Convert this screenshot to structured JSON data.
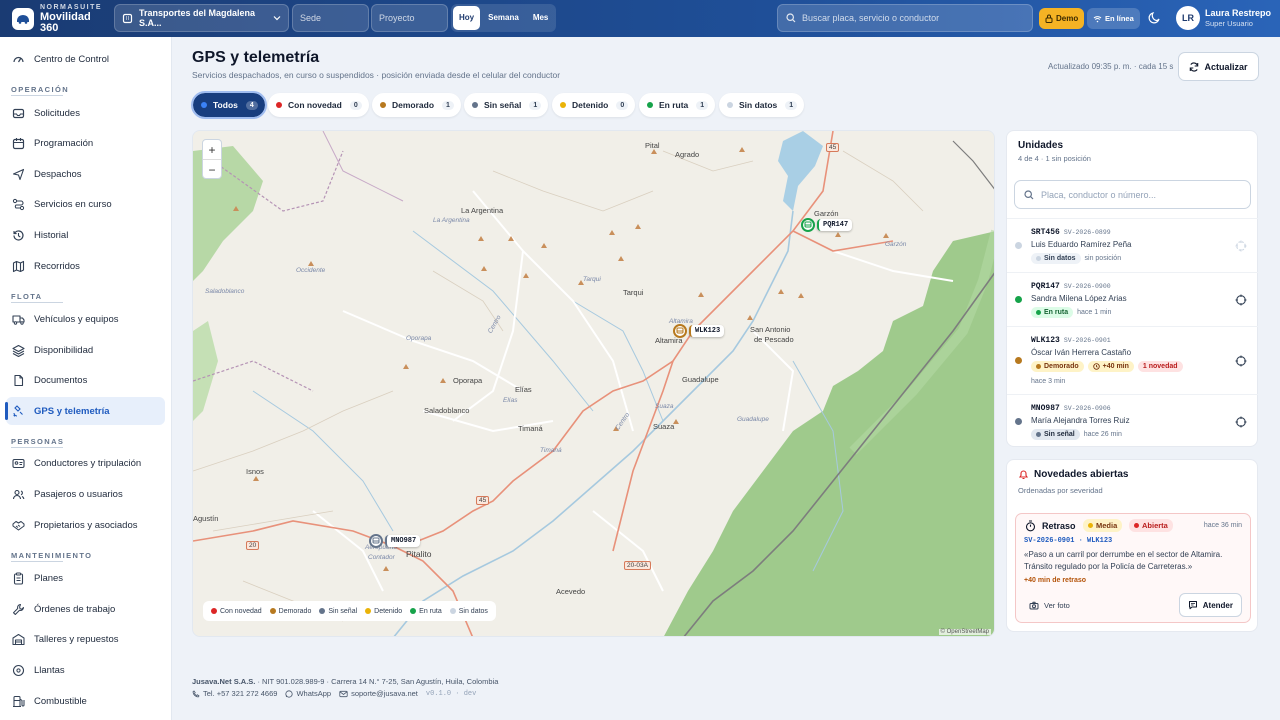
{
  "topbar": {
    "brand_small": "NORMASUITE",
    "brand_large": "Movilidad 360",
    "org": "Transportes del Magdalena S.A...",
    "sede_placeholder": "Sede",
    "proyecto_placeholder": "Proyecto",
    "range": [
      "Hoy",
      "Semana",
      "Mes"
    ],
    "range_active": "Hoy",
    "search_placeholder": "Buscar placa, servicio o conductor",
    "demo": "Demo",
    "online": "En línea",
    "user_initials": "LR",
    "user_name": "Laura Restrepo",
    "user_role": "Super Usuario"
  },
  "sidebar": {
    "top": "Centro de Control",
    "sections": [
      {
        "title": "OPERACIÓN",
        "items": [
          "Solicitudes",
          "Programación",
          "Despachos",
          "Servicios en curso",
          "Historial",
          "Recorridos"
        ]
      },
      {
        "title": "FLOTA",
        "items": [
          "Vehículos y equipos",
          "Disponibilidad",
          "Documentos",
          "GPS y telemetría"
        ]
      },
      {
        "title": "PERSONAS",
        "items": [
          "Conductores y tripulación",
          "Pasajeros o usuarios",
          "Propietarios y asociados"
        ]
      },
      {
        "title": "MANTENIMIENTO",
        "items": [
          "Planes",
          "Órdenes de trabajo",
          "Talleres y repuestos",
          "Llantas",
          "Combustible"
        ]
      }
    ],
    "active": "GPS y telemetría"
  },
  "header": {
    "title": "GPS y telemetría",
    "subtitle": "Servicios despachados, en curso o suspendidos · posición enviada desde el celular del conductor",
    "updated": "Actualizado 09:35 p. m. · cada 15 s",
    "refresh": "Actualizar"
  },
  "filters": [
    {
      "label": "Todos",
      "count": "4",
      "color": "#1f5bbf",
      "active": true
    },
    {
      "label": "Con novedad",
      "count": "0",
      "color": "#dc2626"
    },
    {
      "label": "Demorado",
      "count": "1",
      "color": "#b7791f"
    },
    {
      "label": "Sin señal",
      "count": "1",
      "color": "#64748b"
    },
    {
      "label": "Detenido",
      "count": "0",
      "color": "#eab308"
    },
    {
      "label": "En ruta",
      "count": "1",
      "color": "#16a34a"
    },
    {
      "label": "Sin datos",
      "count": "1",
      "color": "#cbd5e1"
    }
  ],
  "map": {
    "zoom_in": "+",
    "zoom_out": "−",
    "attribution": "© OpenStreetMap",
    "legend": [
      {
        "label": "Con novedad",
        "color": "#dc2626"
      },
      {
        "label": "Demorado",
        "color": "#b7791f"
      },
      {
        "label": "Sin señal",
        "color": "#64748b"
      },
      {
        "label": "Detenido",
        "color": "#eab308"
      },
      {
        "label": "En ruta",
        "color": "#16a34a"
      },
      {
        "label": "Sin datos",
        "color": "#cbd5e1"
      }
    ],
    "markers": [
      {
        "plate": "PQR147",
        "color": "#16a34a"
      },
      {
        "plate": "WLK123",
        "color": "#b7791f"
      },
      {
        "plate": "MNO987",
        "color": "#64748b"
      }
    ],
    "places": {
      "pital": "Pital",
      "agrado": "Agrado",
      "garzon": "Garzón",
      "garzon2": "Garzón",
      "argentina": "La Argentina",
      "argentina2": "La Argentina",
      "occidente": "Occidente",
      "saladoblanco_i": "Saladoblanco",
      "tarqui": "Tarqui",
      "tarqui2": "Tarqui",
      "oporapa_i": "Oporapa",
      "oporapa": "Oporapa",
      "centro": "Centro",
      "altamira": "Altamira",
      "altamira2": "Altamira",
      "san_antonio": "San Antonio",
      "de_pescado": "de Pescado",
      "guadalupe": "Guadalupe",
      "guadalupe2": "Guadalupe",
      "elias": "Elías",
      "elias2": "Elías",
      "saladoblanco": "Saladoblanco",
      "timana": "Timaná",
      "timana2": "Timaná",
      "suaza": "Suaza",
      "suaza2": "Suaza",
      "cerro": "Centro",
      "isnos": "Isnos",
      "agustin": "Agustín",
      "pitalito": "Pitalito",
      "aero1": "Aeropuerto",
      "aero2": "Contador",
      "acevedo": "Acevedo",
      "bruselas": "Bruselas"
    },
    "roads": [
      "45",
      "45",
      "20",
      "20-03A"
    ]
  },
  "units": {
    "title": "Unidades",
    "subtitle": "4 de 4 · 1 sin posición",
    "search_placeholder": "Placa, conductor o número...",
    "items": [
      {
        "plate": "SRT456",
        "service": "SV-2026-0899",
        "driver": "Luis Eduardo Ramírez Peña",
        "status": "Sin datos",
        "status_color": "#cbd5e1",
        "status_bg": "#eef2f7",
        "status_fg": "#334155",
        "ago": "sin posición"
      },
      {
        "plate": "PQR147",
        "service": "SV-2026-0900",
        "driver": "Sandra Milena López Arias",
        "status": "En ruta",
        "status_color": "#16a34a",
        "status_bg": "#dcfce7",
        "status_fg": "#166534",
        "ago": "hace 1 min"
      },
      {
        "plate": "WLK123",
        "service": "SV-2026-0901",
        "driver": "Óscar Iván Herrera Castaño",
        "status": "Demorado",
        "status_color": "#b7791f",
        "status_bg": "#fef3c7",
        "status_fg": "#78350f",
        "delay": "+40 min",
        "novedad": "1 novedad",
        "ago": "hace 3 min"
      },
      {
        "plate": "MNO987",
        "service": "SV-2026-0906",
        "driver": "María Alejandra Torres Ruiz",
        "status": "Sin señal",
        "status_color": "#64748b",
        "status_bg": "#e2e8f0",
        "status_fg": "#1e293b",
        "ago": "hace 26 min"
      }
    ]
  },
  "novedades": {
    "title": "Novedades abiertas",
    "subtitle": "Ordenadas por severidad",
    "card": {
      "type": "Retraso",
      "severity": "Media",
      "state": "Abierta",
      "ago": "hace 36 min",
      "ref": "SV-2026-0901 · WLK123",
      "text": "«Paso a un carril por derrumbe en el sector de Altamira. Tránsito regulado por la Policía de Carreteras.»",
      "delay": "+40 min de retraso",
      "photo": "Ver foto",
      "attend": "Atender"
    }
  },
  "footer": {
    "company": "Jusava.Net S.A.S.",
    "details": " · NIT 901.028.989-9 · Carrera 14 N.° 7-25, San Agustín, Huila, Colombia",
    "phone": "Tel. +57 321 272 4669",
    "whatsapp": "WhatsApp",
    "email": "soporte@jusava.net",
    "version": "v0.1.0 · dev"
  }
}
